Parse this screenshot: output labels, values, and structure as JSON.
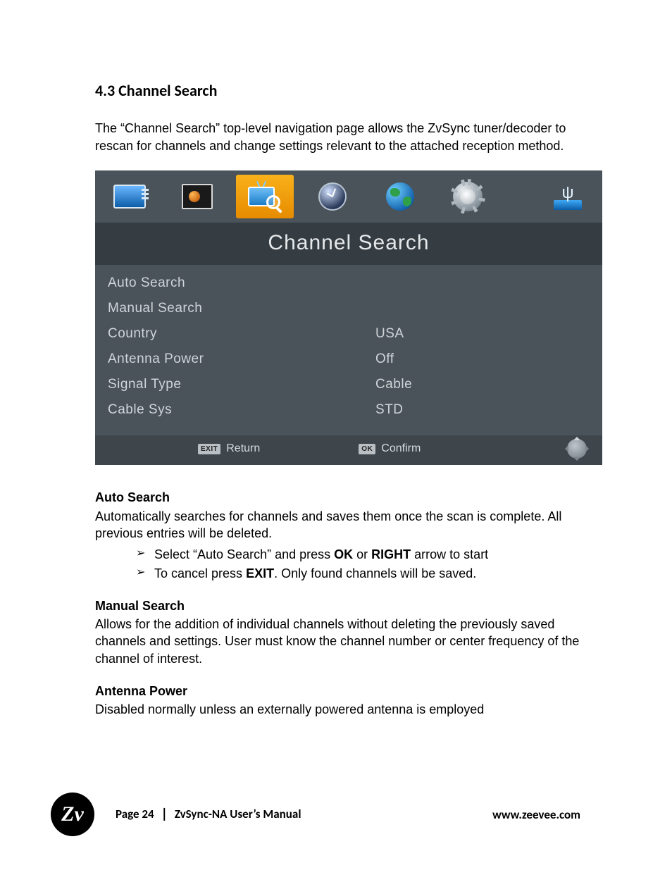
{
  "heading": "4.3  Channel Search",
  "intro": "The “Channel Search” top-level navigation page allows the ZvSync tuner/decoder to rescan for channels and change settings relevant to the attached reception method.",
  "osd": {
    "title": "Channel Search",
    "nav_icons": [
      "monitor",
      "image",
      "channel-search",
      "clock",
      "globe",
      "gear",
      "usb"
    ],
    "selected_index": 2,
    "items": [
      {
        "label": "Auto Search",
        "value": ""
      },
      {
        "label": "Manual Search",
        "value": ""
      },
      {
        "label": "Country",
        "value": "USA"
      },
      {
        "label": "Antenna Power",
        "value": "Off"
      },
      {
        "label": "Signal Type",
        "value": "Cable"
      },
      {
        "label": "Cable Sys",
        "value": "STD"
      }
    ],
    "hints": {
      "return_badge": "EXIT",
      "return_label": "Return",
      "confirm_badge": "OK",
      "confirm_label": "Confirm"
    }
  },
  "sections": {
    "auto_search": {
      "title": "Auto Search",
      "body": "Automatically searches for channels and saves them once the scan is complete.  All previous entries will be deleted.",
      "bullets": {
        "b1_pre": "Select “Auto Search” and press ",
        "b1_ok": "OK",
        "b1_mid": " or ",
        "b1_right": "RIGHT",
        "b1_post": " arrow to start",
        "b2_pre": "To cancel press ",
        "b2_exit": "EXIT",
        "b2_post": ".  Only found channels will be saved."
      }
    },
    "manual_search": {
      "title": "Manual Search",
      "body": "Allows for the addition of individual channels without deleting the previously saved channels and settings.  User must know the channel number or center frequency of the channel of interest."
    },
    "antenna_power": {
      "title": "Antenna Power",
      "body": "Disabled normally unless an externally powered antenna is employed"
    }
  },
  "footer": {
    "logo_text": "Zv",
    "page_label": "Page 24",
    "divider": "|",
    "doc_title": "ZvSync-NA User’s Manual",
    "url": "www.zeevee.com"
  }
}
